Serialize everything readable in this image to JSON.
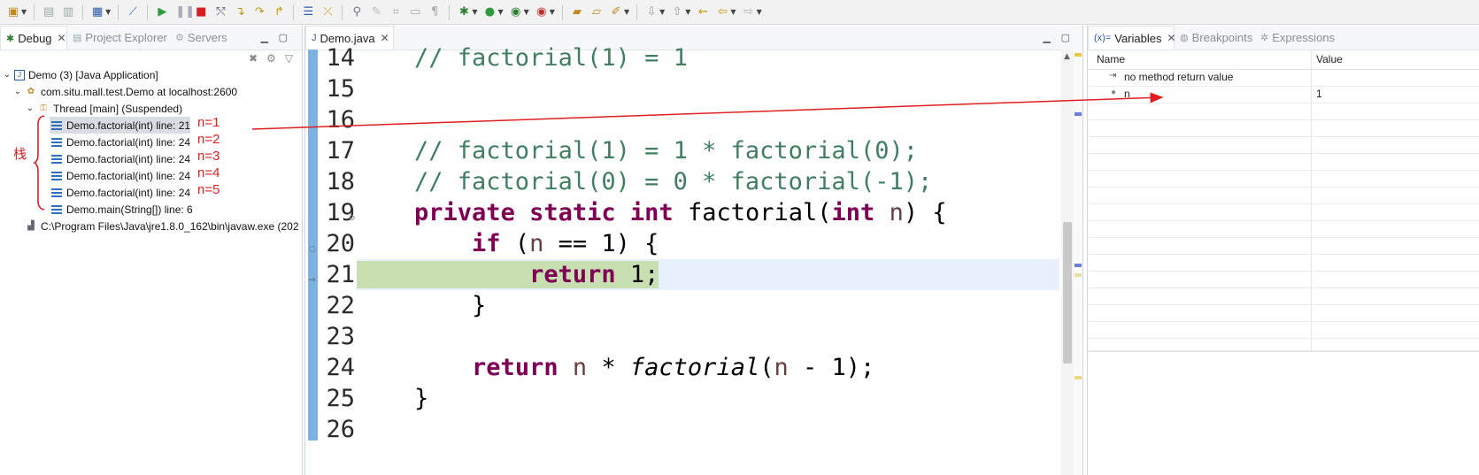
{
  "toolbar": {
    "icons": [
      "new-file",
      "save",
      "save-all",
      "debug-view",
      "skip-breakpoints",
      "resume",
      "suspend",
      "terminate",
      "disconnect",
      "step-into",
      "step-over",
      "step-return",
      "drop-to-frame",
      "use-step-filters",
      "run-to-line",
      "debug",
      "run",
      "coverage",
      "external-tools",
      "new-java-project",
      "open-type",
      "search",
      "navigate-back",
      "navigate-forward"
    ]
  },
  "debug_view": {
    "tabs": [
      {
        "label": "Debug"
      },
      {
        "label": "Project Explorer"
      },
      {
        "label": "Servers"
      }
    ],
    "tree": [
      {
        "text": "Demo (3) [Java Application]"
      },
      {
        "text": "com.situ.mall.test.Demo at localhost:2600"
      },
      {
        "text": "Thread [main] (Suspended)"
      },
      {
        "text": "Demo.factorial(int) line: 21"
      },
      {
        "text": "Demo.factorial(int) line: 24"
      },
      {
        "text": "Demo.factorial(int) line: 24"
      },
      {
        "text": "Demo.factorial(int) line: 24"
      },
      {
        "text": "Demo.factorial(int) line: 24"
      },
      {
        "text": "Demo.main(String[]) line: 6"
      },
      {
        "text": "C:\\Program Files\\Java\\jre1.8.0_162\\bin\\javaw.exe (202"
      }
    ],
    "annotations": {
      "stack_label": "栈",
      "frame_labels": [
        "n=1",
        "n=2",
        "n=3",
        "n=4",
        "n=5"
      ]
    }
  },
  "editor": {
    "tab_label": "Demo.java",
    "line_numbers": [
      "14",
      "15",
      "16",
      "17",
      "18",
      "19",
      "20",
      "21",
      "22",
      "23",
      "24",
      "25",
      "26"
    ],
    "code": {
      "l14": "    // factorial(1) = 1",
      "l17": "    // factorial(1) = 1 * factorial(0);",
      "l18": "    // factorial(0) = 0 * factorial(-1);",
      "l19_kw1": "private",
      "l19_kw2": "static",
      "l19_kw3": "int",
      "l19_name": "factorial(",
      "l19_kw4": "int",
      "l19_param": "n",
      "l19_end": ") {",
      "l20_kw": "if",
      "l20_a": " (",
      "l20_var": "n",
      "l20_b": " == 1) {",
      "l21_kw": "return",
      "l21_rest": " 1;",
      "l22": "        }",
      "l24_kw": "return",
      "l24_var1": "n",
      "l24_op": " * ",
      "l24_call": "factorial",
      "l24_a": "(",
      "l24_var2": "n",
      "l24_b": " - 1);",
      "l25": "    }"
    }
  },
  "variables_view": {
    "tabs": [
      {
        "label": "Variables"
      },
      {
        "label": "Breakpoints"
      },
      {
        "label": "Expressions"
      }
    ],
    "columns": {
      "name": "Name",
      "value": "Value"
    },
    "rows": [
      {
        "name": "no method return value",
        "value": ""
      },
      {
        "name": "n",
        "value": "1"
      }
    ]
  },
  "colors": {
    "annotation": "#e02020",
    "keyword": "#7f0055",
    "comment": "#3f7f5f",
    "current_line_highlight": "#c7dfb1"
  }
}
